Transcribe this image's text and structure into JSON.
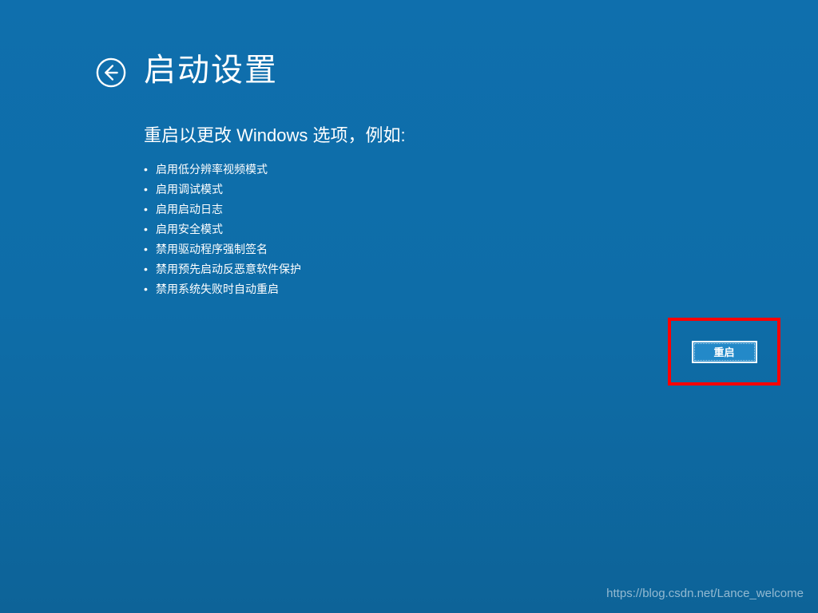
{
  "header": {
    "title": "启动设置"
  },
  "content": {
    "subtitle": "重启以更改 Windows 选项，例如:",
    "options": [
      "启用低分辨率视频模式",
      "启用调试模式",
      "启用启动日志",
      "启用安全模式",
      "禁用驱动程序强制签名",
      "禁用预先启动反恶意软件保护",
      "禁用系统失败时自动重启"
    ]
  },
  "actions": {
    "restart_label": "重启"
  },
  "watermark": "https://blog.csdn.net/Lance_welcome"
}
